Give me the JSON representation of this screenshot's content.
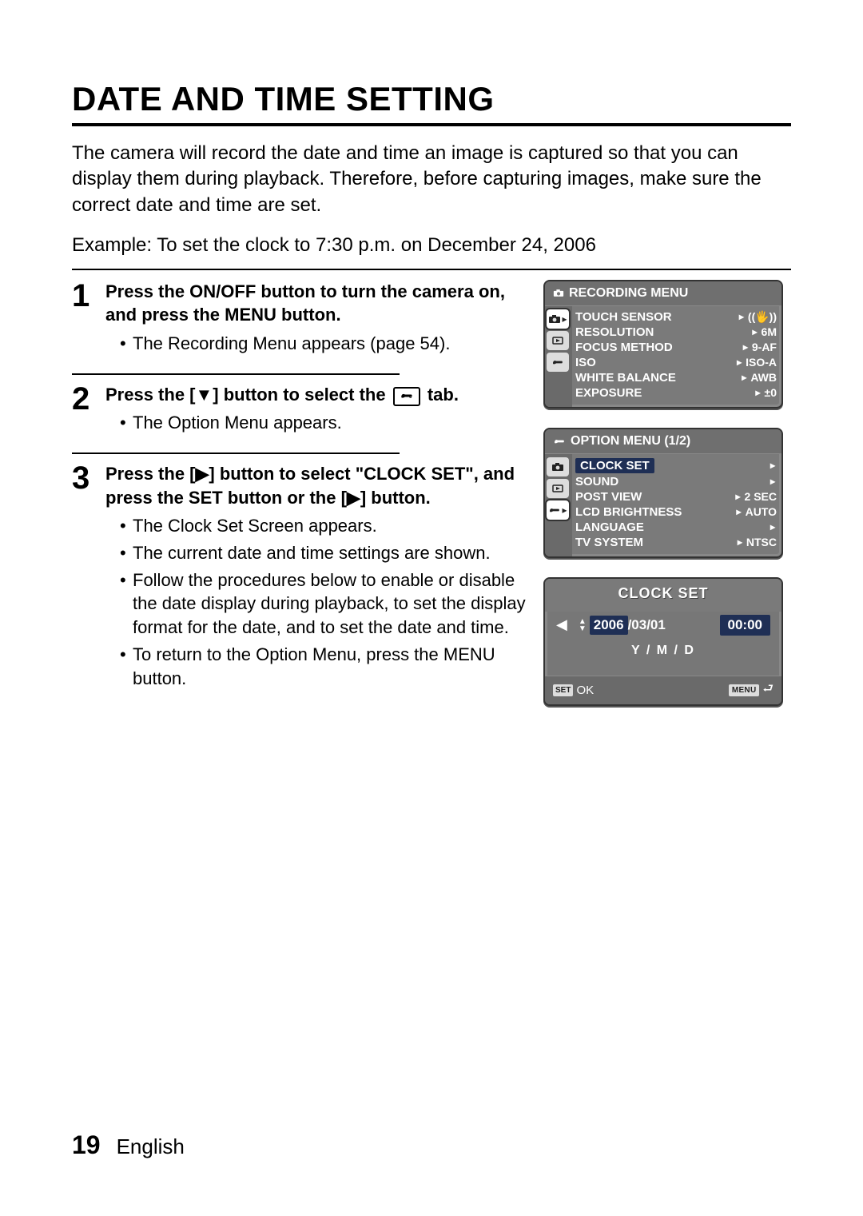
{
  "title": "DATE AND TIME SETTING",
  "intro": "The camera will record the date and time an image is captured so that you can display them during playback. Therefore, before capturing images, make sure the correct date and time are set.",
  "example": "Example: To set the clock to 7:30 p.m. on December 24, 2006",
  "steps": [
    {
      "num": "1",
      "head": "Press the ON/OFF button to turn the camera on, and press the MENU button.",
      "bullets": [
        "The Recording Menu appears (page 54)."
      ]
    },
    {
      "num": "2",
      "head_prefix": "Press the [▼] button to select the ",
      "head_suffix": " tab.",
      "bullets": [
        "The Option Menu appears."
      ]
    },
    {
      "num": "3",
      "head": "Press the [▶] button to select \"CLOCK SET\", and press the SET button or the [▶] button.",
      "bullets": [
        "The Clock Set Screen appears.",
        "The current date and time settings are shown.",
        "Follow the procedures below to enable or disable the date display during playback, to set the display format for the date, and to set the date and time.",
        "To return to the Option Menu, press the MENU button."
      ]
    }
  ],
  "recording_menu": {
    "title": "RECORDING MENU",
    "items": [
      {
        "label": "TOUCH SENSOR",
        "value_kind": "sensor-icon"
      },
      {
        "label": "RESOLUTION",
        "value": "6M"
      },
      {
        "label": "FOCUS METHOD",
        "value": "9-AF"
      },
      {
        "label": "ISO",
        "value": "ISO-A"
      },
      {
        "label": "WHITE BALANCE",
        "value": "AWB"
      },
      {
        "label": "EXPOSURE",
        "value": "±0"
      }
    ]
  },
  "option_menu": {
    "title": "OPTION MENU (1/2)",
    "items": [
      {
        "label": "CLOCK SET",
        "value": ""
      },
      {
        "label": "SOUND",
        "value": ""
      },
      {
        "label": "POST VIEW",
        "value": "2 SEC"
      },
      {
        "label": "LCD BRIGHTNESS",
        "value": "AUTO"
      },
      {
        "label": "LANGUAGE",
        "value": ""
      },
      {
        "label": "TV SYSTEM",
        "value": "NTSC"
      }
    ]
  },
  "clock_set": {
    "title": "CLOCK SET",
    "date": "2006/03/01",
    "date_year": "2006",
    "date_rest": "/03/01",
    "time": "00:00",
    "format": "Y / M / D",
    "ok": "OK",
    "set_label": "SET",
    "menu_label": "MENU"
  },
  "footer": {
    "page": "19",
    "language": "English"
  }
}
